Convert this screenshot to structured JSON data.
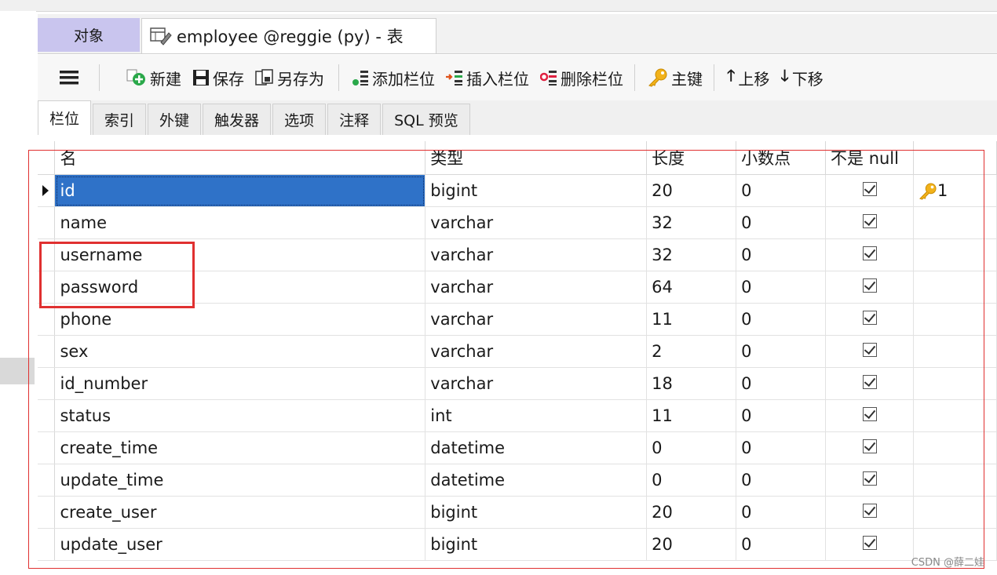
{
  "tabs": {
    "objects_label": "对象",
    "document_label": "employee @reggie (py) - 表"
  },
  "toolbar": {
    "new_label": "新建",
    "save_label": "保存",
    "save_as_label": "另存为",
    "add_column_label": "添加栏位",
    "insert_column_label": "插入栏位",
    "delete_column_label": "删除栏位",
    "primary_key_label": "主键",
    "move_up_label": "上移",
    "move_down_label": "下移"
  },
  "subtabs": [
    "栏位",
    "索引",
    "外键",
    "触发器",
    "选项",
    "注释",
    "SQL 预览"
  ],
  "grid": {
    "headers": {
      "name": "名",
      "type": "类型",
      "length": "长度",
      "decimal": "小数点",
      "not_null": "不是 null",
      "key": ""
    },
    "rows": [
      {
        "name": "id",
        "type": "bigint",
        "length": "20",
        "decimal": "0",
        "not_null": true,
        "key": "1"
      },
      {
        "name": "name",
        "type": "varchar",
        "length": "32",
        "decimal": "0",
        "not_null": true,
        "key": ""
      },
      {
        "name": "username",
        "type": "varchar",
        "length": "32",
        "decimal": "0",
        "not_null": true,
        "key": ""
      },
      {
        "name": "password",
        "type": "varchar",
        "length": "64",
        "decimal": "0",
        "not_null": true,
        "key": ""
      },
      {
        "name": "phone",
        "type": "varchar",
        "length": "11",
        "decimal": "0",
        "not_null": true,
        "key": ""
      },
      {
        "name": "sex",
        "type": "varchar",
        "length": "2",
        "decimal": "0",
        "not_null": true,
        "key": ""
      },
      {
        "name": "id_number",
        "type": "varchar",
        "length": "18",
        "decimal": "0",
        "not_null": true,
        "key": ""
      },
      {
        "name": "status",
        "type": "int",
        "length": "11",
        "decimal": "0",
        "not_null": true,
        "key": ""
      },
      {
        "name": "create_time",
        "type": "datetime",
        "length": "0",
        "decimal": "0",
        "not_null": true,
        "key": ""
      },
      {
        "name": "update_time",
        "type": "datetime",
        "length": "0",
        "decimal": "0",
        "not_null": true,
        "key": ""
      },
      {
        "name": "create_user",
        "type": "bigint",
        "length": "20",
        "decimal": "0",
        "not_null": true,
        "key": ""
      },
      {
        "name": "update_user",
        "type": "bigint",
        "length": "20",
        "decimal": "0",
        "not_null": true,
        "key": ""
      }
    ]
  },
  "watermark": "CSDN @薛二娃",
  "colors": {
    "selected_cell": "#2f72c8",
    "highlight_box": "#e03030",
    "objects_tab": "#c9c5ee"
  }
}
